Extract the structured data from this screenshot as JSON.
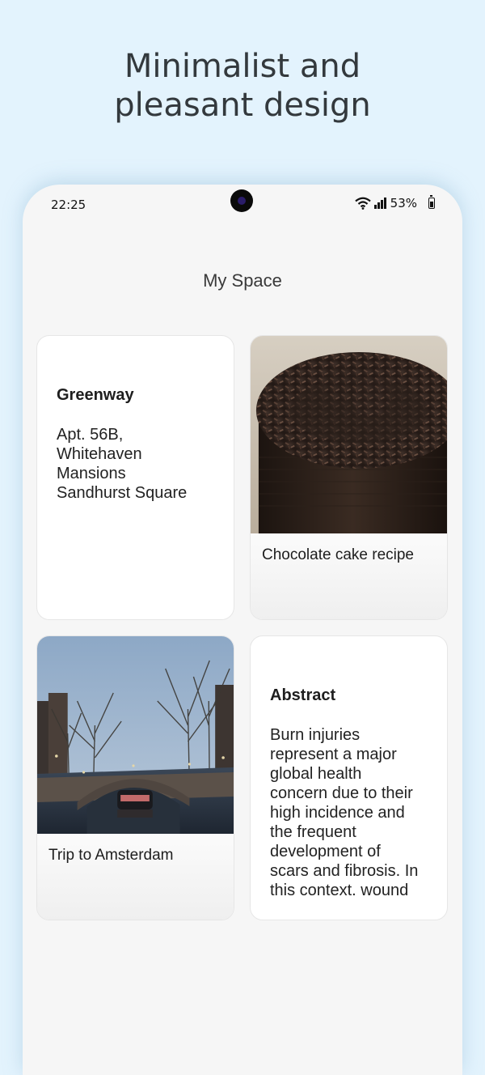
{
  "promo": {
    "headline_line1": "Minimalist and",
    "headline_line2": "pleasant design"
  },
  "status_bar": {
    "time": "22:25",
    "battery_percent": "53%",
    "icons": [
      "wifi-icon",
      "signal-icon",
      "battery-icon"
    ]
  },
  "screen": {
    "title": "My Space"
  },
  "notes": [
    {
      "type": "text",
      "title": "Greenway",
      "body": "Apt. 56B,\nWhitehaven\nMansions\nSandhurst Square"
    },
    {
      "type": "image",
      "image": "chocolate-cake-photo",
      "caption": "Chocolate cake recipe"
    },
    {
      "type": "image",
      "image": "amsterdam-canal-photo",
      "caption": "Trip to Amsterdam"
    },
    {
      "type": "text",
      "title": "Abstract",
      "body": "Burn injuries\nrepresent a major\nglobal health\nconcern due to their\nhigh incidence and\nthe frequent\ndevelopment of\nscars and fibrosis. In\nthis context. wound"
    }
  ],
  "colors": {
    "background": "#e3f3fd",
    "phone_screen": "#f6f6f6",
    "card": "#ffffff"
  }
}
